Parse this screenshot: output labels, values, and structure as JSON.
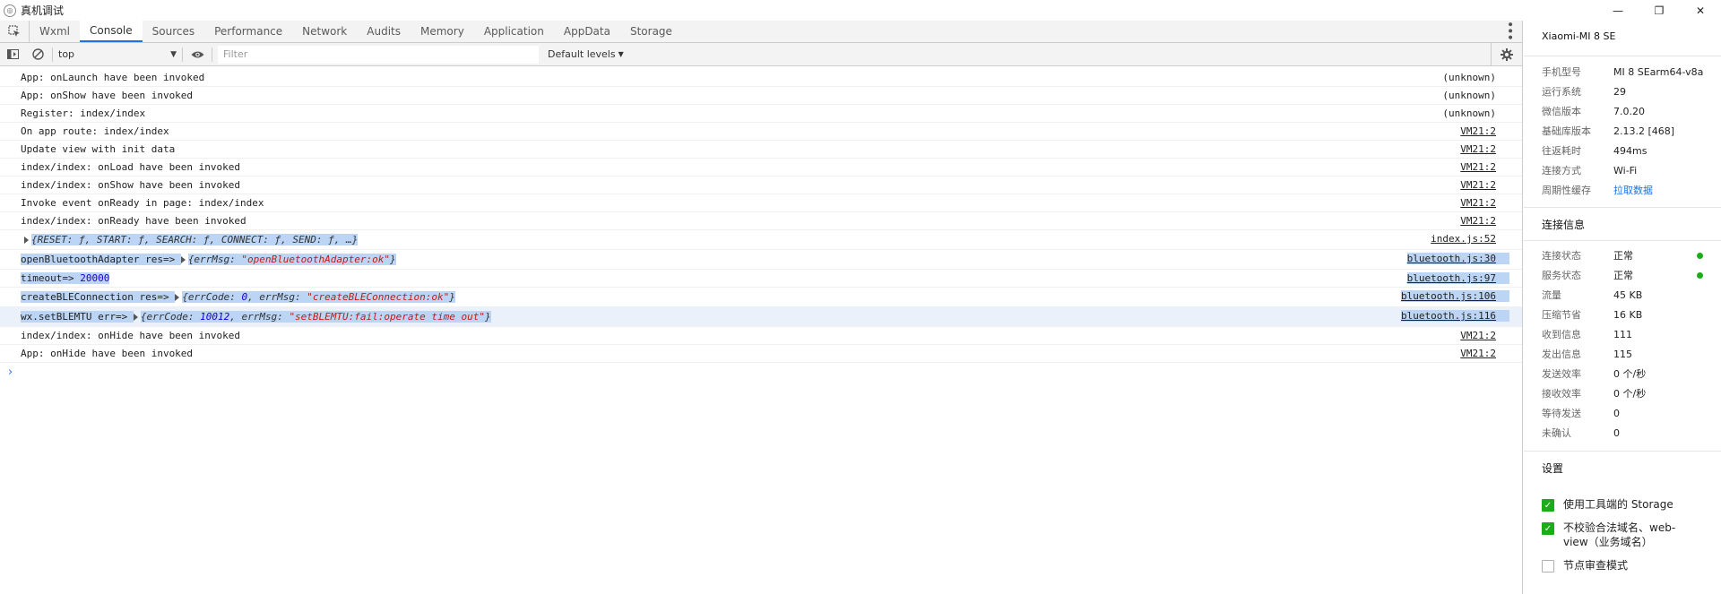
{
  "window": {
    "title": "真机调试",
    "minimize": "—",
    "restore": "❐",
    "close": "✕"
  },
  "tabs": [
    {
      "label": "Wxml"
    },
    {
      "label": "Console",
      "active": true
    },
    {
      "label": "Sources"
    },
    {
      "label": "Performance"
    },
    {
      "label": "Network"
    },
    {
      "label": "Audits"
    },
    {
      "label": "Memory"
    },
    {
      "label": "Application"
    },
    {
      "label": "AppData"
    },
    {
      "label": "Storage"
    }
  ],
  "toolbar": {
    "context": "top",
    "filter_placeholder": "Filter",
    "levels": "Default levels"
  },
  "console": {
    "rows": [
      {
        "text": "App: onLaunch have been invoked",
        "source": "(unknown)"
      },
      {
        "text": "App: onShow have been invoked",
        "source": "(unknown)"
      },
      {
        "text": "Register: index/index",
        "source": "(unknown)"
      },
      {
        "text": "On app route: index/index",
        "source": "VM21:2"
      },
      {
        "text": "Update view with init data",
        "source": "VM21:2"
      },
      {
        "text": "index/index: onLoad have been invoked",
        "source": "VM21:2"
      },
      {
        "text": "index/index: onShow have been invoked",
        "source": "VM21:2"
      },
      {
        "text": "Invoke event onReady in page: index/index",
        "source": "VM21:2"
      },
      {
        "text": "index/index: onReady have been invoked",
        "source": "VM21:2"
      },
      {
        "object": "{RESET: ƒ, START: ƒ, SEARCH: ƒ, CONNECT: ƒ, SEND: ƒ, …}",
        "source": "index.js:52"
      },
      {
        "prefix": "openBluetoothAdapter res=>",
        "object_pre": "{errMsg: ",
        "object_str": "\"openBluetoothAdapter:ok\"",
        "object_post": "}",
        "source": "bluetooth.js:30"
      },
      {
        "prefix": "timeout=>",
        "number": "20000",
        "source": "bluetooth.js:97"
      },
      {
        "prefix": "createBLEConnection res=>",
        "object_pre": "{errCode: ",
        "object_num": "0",
        "object_mid": ", errMsg: ",
        "object_str": "\"createBLEConnection:ok\"",
        "object_post": "}",
        "source": "bluetooth.js:106"
      },
      {
        "prefix": "wx.setBLEMTU err=>",
        "object_pre": "{errCode: ",
        "object_num": "10012",
        "object_mid": ", errMsg: ",
        "object_str": "\"setBLEMTU:fail:operate time out\"",
        "object_post": "}",
        "source": "bluetooth.js:116"
      },
      {
        "text": "index/index: onHide have been invoked",
        "source": "VM21:2"
      },
      {
        "text": "App: onHide have been invoked",
        "source": "VM21:2"
      }
    ],
    "prompt": "›"
  },
  "panel": {
    "device": "Xiaomi-MI 8 SE",
    "info": [
      {
        "label": "手机型号",
        "value": "MI 8 SEarm64-v8a"
      },
      {
        "label": "运行系统",
        "value": "29"
      },
      {
        "label": "微信版本",
        "value": "7.0.20"
      },
      {
        "label": "基础库版本",
        "value": "2.13.2 [468]"
      },
      {
        "label": "往返耗时",
        "value": "494ms"
      },
      {
        "label": "连接方式",
        "value": "Wi-Fi"
      },
      {
        "label": "周期性缓存",
        "value": "拉取数据"
      }
    ],
    "conn_title": "连接信息",
    "conn": [
      {
        "label": "连接状态",
        "value": "正常"
      },
      {
        "label": "服务状态",
        "value": "正常"
      },
      {
        "label": "流量",
        "value": "45 KB"
      },
      {
        "label": "压缩节省",
        "value": "16 KB"
      },
      {
        "label": "收到信息",
        "value": "111"
      },
      {
        "label": "发出信息",
        "value": "115"
      },
      {
        "label": "发送效率",
        "value": "0 个/秒"
      },
      {
        "label": "接收效率",
        "value": "0 个/秒"
      },
      {
        "label": "等待发送",
        "value": "0"
      },
      {
        "label": "未确认",
        "value": "0"
      }
    ],
    "settings_title": "设置",
    "settings": [
      {
        "label": "使用工具端的 Storage",
        "checked": true
      },
      {
        "label": "不校验合法域名、web-view（业务域名）",
        "checked": true
      },
      {
        "label": "节点审查模式",
        "checked": false
      }
    ],
    "status_color": "#1aad19"
  }
}
